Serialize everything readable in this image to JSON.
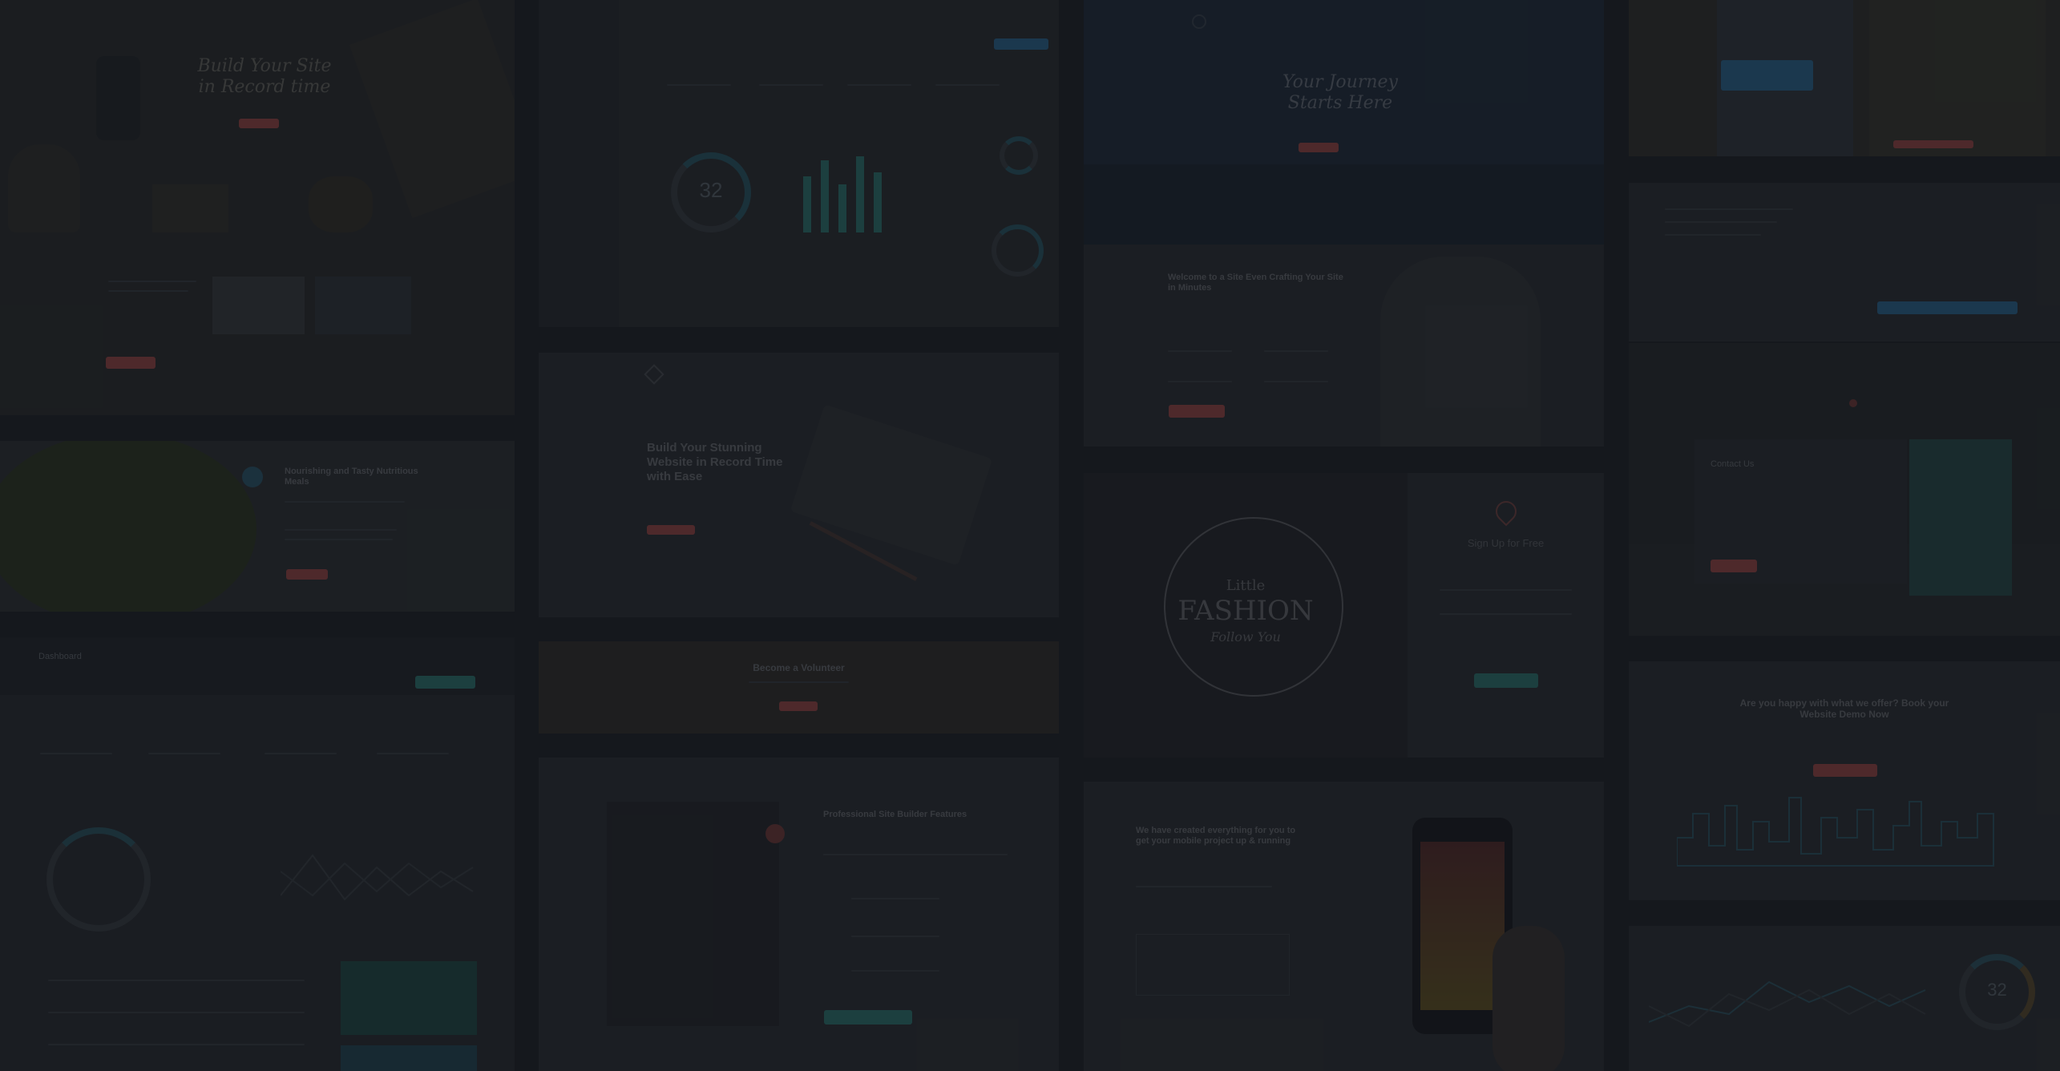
{
  "colors": {
    "background": "#1e2226",
    "tile": "#2a2e33",
    "accent_red": "#a54b48",
    "accent_teal": "#2e7f78",
    "accent_blue": "#2c6f9b",
    "overlay": "rgba(15,18,22,0.58)"
  },
  "tiles": {
    "col1": {
      "hero": {
        "title": "Build Your Site in Record time"
      },
      "nature": {
        "title": "Nourishing and Tasty Nutritious Meals"
      },
      "dashboard": {
        "brand": "Dashboard"
      }
    },
    "col2": {
      "analytics": {
        "donut_value": "32"
      },
      "builder": {
        "title": "Build Your Stunning Website in Record Time with Ease"
      },
      "volunteer": {
        "title": "Become a Volunteer"
      },
      "profile": {
        "title": "Professional Site Builder Features"
      }
    },
    "col3": {
      "travel": {
        "title": "Your Journey Starts Here"
      },
      "person": {
        "title": "Welcome to a Site Even Crafting Your Site in Minutes"
      },
      "fashion": {
        "line1": "Little",
        "line2": "FASHION",
        "line3": "Follow You"
      },
      "signup": {
        "title": "Sign Up for Free"
      },
      "mobile": {
        "title": "We have created everything for you to get your mobile project up & running"
      }
    },
    "col4": {
      "cta": {
        "title": "Are you happy with what we offer? Book your Website Demo Now"
      },
      "contact": {
        "label": "Contact Us"
      },
      "chart_value": "32"
    }
  }
}
